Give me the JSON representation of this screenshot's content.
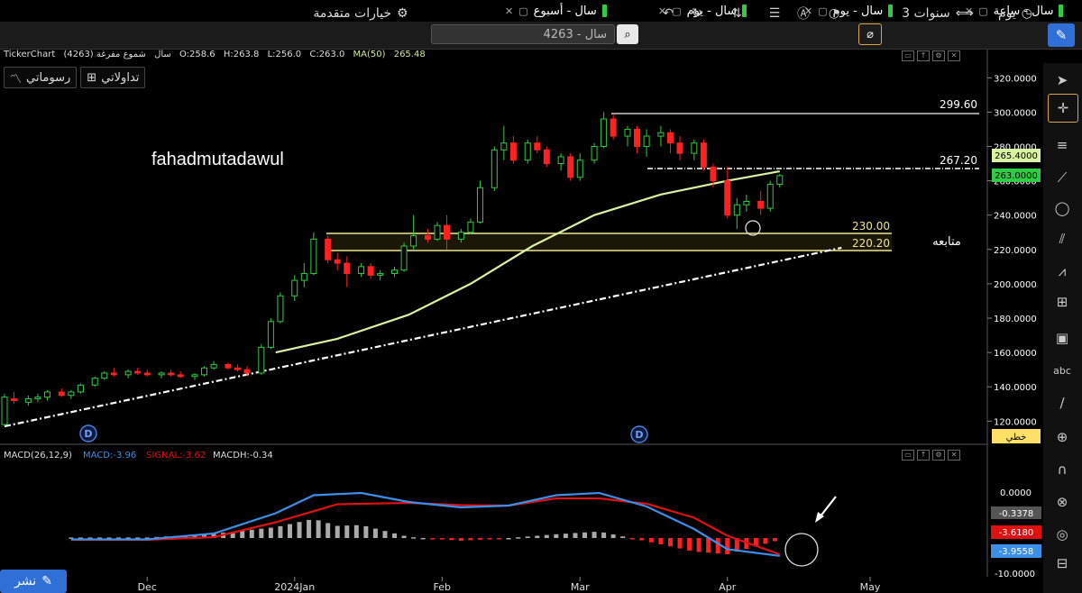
{
  "tabs": [
    {
      "label": "سال - ساعة"
    },
    {
      "label": "سال - يوم"
    },
    {
      "label": "سال - يوم"
    },
    {
      "label": "سال - أسبوع"
    }
  ],
  "toolbar": {
    "interval": "يوم",
    "range": "3 سنوات",
    "advanced_options": "خيارات متقدمة",
    "search_value": "4263 - سال"
  },
  "chart_info": {
    "app": "TickerChart",
    "symbol": "(4263) سال",
    "chart_kind": "شموع مفرغة",
    "open": "O:258.6",
    "high": "H:263.8",
    "low": "L:256.0",
    "close": "C:263.0",
    "ma_label": "MA(50)",
    "ma_value": "265.48"
  },
  "sub_buttons": {
    "trades": "تداولاتي",
    "drawings": "رسوماتي"
  },
  "watermark": "fahadmutadawul",
  "annotations": {
    "follow": "متابعه",
    "line_style": "خطي"
  },
  "price_axis": {
    "ticks": [
      "320.0000",
      "300.0000",
      "280.0000",
      "260.0000",
      "240.0000",
      "220.0000",
      "200.0000",
      "180.0000",
      "160.0000",
      "140.0000",
      "120.0000"
    ],
    "ma_tag": "265.4000",
    "close_tag": "263.0000"
  },
  "levels": [
    {
      "label": "299.60",
      "value": 299.6
    },
    {
      "label": "267.20",
      "value": 267.2
    },
    {
      "label": "230.00",
      "value": 230.0
    },
    {
      "label": "220.20",
      "value": 220.2
    }
  ],
  "macd": {
    "title": "MACD(26,12,9)",
    "macd_label": "MACD:-3.96",
    "signal_label": "SIGNAL:-3.62",
    "hist_label": "MACDH:-0.34",
    "ticks": [
      "0.0000",
      "-10.0000"
    ],
    "tags": [
      "-0.3378",
      "-3.6180",
      "-3.9558"
    ]
  },
  "x_axis": [
    "Dec",
    "2024Jan",
    "Feb",
    "Mar",
    "Apr",
    "May"
  ],
  "publish": "نشر",
  "colors": {
    "up": "#2ecc40",
    "down": "#ff2020",
    "ma": "#d9f2a0",
    "macd": "#3b8fe8",
    "signal": "#e01010",
    "level": "#f0e68c",
    "accent": "#2f6fd6"
  },
  "chart_data": {
    "type": "candlestick",
    "ylim": [
      115,
      330
    ],
    "x_range": [
      "2023-11-01",
      "2024-05-10"
    ],
    "ohlc": [
      {
        "date": "2023-11-01",
        "o": 118,
        "h": 136,
        "l": 117,
        "c": 134
      },
      {
        "date": "2023-11-03",
        "o": 133,
        "h": 137,
        "l": 130,
        "c": 132
      },
      {
        "date": "2023-11-06",
        "o": 131,
        "h": 135,
        "l": 129,
        "c": 133
      },
      {
        "date": "2023-11-08",
        "o": 133,
        "h": 136,
        "l": 131,
        "c": 134
      },
      {
        "date": "2023-11-10",
        "o": 134,
        "h": 138,
        "l": 132,
        "c": 137
      },
      {
        "date": "2023-11-13",
        "o": 137,
        "h": 139,
        "l": 134,
        "c": 135
      },
      {
        "date": "2023-11-15",
        "o": 135,
        "h": 138,
        "l": 133,
        "c": 137
      },
      {
        "date": "2023-11-17",
        "o": 137,
        "h": 142,
        "l": 136,
        "c": 141
      },
      {
        "date": "2023-11-20",
        "o": 141,
        "h": 146,
        "l": 140,
        "c": 145
      },
      {
        "date": "2023-11-22",
        "o": 145,
        "h": 149,
        "l": 144,
        "c": 148
      },
      {
        "date": "2023-11-24",
        "o": 148,
        "h": 151,
        "l": 146,
        "c": 147
      },
      {
        "date": "2023-11-27",
        "o": 147,
        "h": 150,
        "l": 145,
        "c": 149
      },
      {
        "date": "2023-11-29",
        "o": 149,
        "h": 151,
        "l": 147,
        "c": 148
      },
      {
        "date": "2023-12-01",
        "o": 148,
        "h": 150,
        "l": 146,
        "c": 147
      },
      {
        "date": "2023-12-04",
        "o": 147,
        "h": 149,
        "l": 145,
        "c": 148
      },
      {
        "date": "2023-12-06",
        "o": 148,
        "h": 150,
        "l": 146,
        "c": 147
      },
      {
        "date": "2023-12-08",
        "o": 147,
        "h": 149,
        "l": 145,
        "c": 146
      },
      {
        "date": "2023-12-11",
        "o": 146,
        "h": 148,
        "l": 144,
        "c": 147
      },
      {
        "date": "2023-12-13",
        "o": 147,
        "h": 152,
        "l": 146,
        "c": 151
      },
      {
        "date": "2023-12-15",
        "o": 151,
        "h": 155,
        "l": 150,
        "c": 153
      },
      {
        "date": "2023-12-18",
        "o": 153,
        "h": 154,
        "l": 150,
        "c": 151
      },
      {
        "date": "2023-12-20",
        "o": 151,
        "h": 153,
        "l": 149,
        "c": 150
      },
      {
        "date": "2023-12-22",
        "o": 150,
        "h": 152,
        "l": 146,
        "c": 148
      },
      {
        "date": "2023-12-25",
        "o": 148,
        "h": 165,
        "l": 147,
        "c": 163
      },
      {
        "date": "2023-12-27",
        "o": 163,
        "h": 180,
        "l": 162,
        "c": 178
      },
      {
        "date": "2023-12-29",
        "o": 178,
        "h": 195,
        "l": 177,
        "c": 193
      },
      {
        "date": "2024-01-01",
        "o": 193,
        "h": 205,
        "l": 190,
        "c": 202
      },
      {
        "date": "2024-01-03",
        "o": 202,
        "h": 212,
        "l": 198,
        "c": 206
      },
      {
        "date": "2024-01-05",
        "o": 206,
        "h": 230,
        "l": 205,
        "c": 226
      },
      {
        "date": "2024-01-08",
        "o": 226,
        "h": 228,
        "l": 212,
        "c": 214
      },
      {
        "date": "2024-01-10",
        "o": 214,
        "h": 218,
        "l": 208,
        "c": 212
      },
      {
        "date": "2024-01-12",
        "o": 212,
        "h": 216,
        "l": 198,
        "c": 206
      },
      {
        "date": "2024-01-15",
        "o": 206,
        "h": 212,
        "l": 204,
        "c": 210
      },
      {
        "date": "2024-01-17",
        "o": 210,
        "h": 212,
        "l": 203,
        "c": 205
      },
      {
        "date": "2024-01-19",
        "o": 205,
        "h": 208,
        "l": 202,
        "c": 206
      },
      {
        "date": "2024-01-22",
        "o": 206,
        "h": 210,
        "l": 204,
        "c": 208
      },
      {
        "date": "2024-01-24",
        "o": 208,
        "h": 224,
        "l": 207,
        "c": 222
      },
      {
        "date": "2024-01-26",
        "o": 222,
        "h": 240,
        "l": 220,
        "c": 228
      },
      {
        "date": "2024-01-29",
        "o": 228,
        "h": 232,
        "l": 224,
        "c": 226
      },
      {
        "date": "2024-01-31",
        "o": 226,
        "h": 236,
        "l": 225,
        "c": 234
      },
      {
        "date": "2024-02-02",
        "o": 234,
        "h": 240,
        "l": 220,
        "c": 226
      },
      {
        "date": "2024-02-05",
        "o": 226,
        "h": 232,
        "l": 224,
        "c": 230
      },
      {
        "date": "2024-02-07",
        "o": 230,
        "h": 238,
        "l": 229,
        "c": 236
      },
      {
        "date": "2024-02-09",
        "o": 236,
        "h": 260,
        "l": 235,
        "c": 256
      },
      {
        "date": "2024-02-12",
        "o": 256,
        "h": 280,
        "l": 254,
        "c": 278
      },
      {
        "date": "2024-02-14",
        "o": 278,
        "h": 292,
        "l": 272,
        "c": 282
      },
      {
        "date": "2024-02-16",
        "o": 282,
        "h": 286,
        "l": 270,
        "c": 272
      },
      {
        "date": "2024-02-19",
        "o": 272,
        "h": 284,
        "l": 270,
        "c": 282
      },
      {
        "date": "2024-02-21",
        "o": 282,
        "h": 286,
        "l": 276,
        "c": 278
      },
      {
        "date": "2024-02-23",
        "o": 278,
        "h": 280,
        "l": 268,
        "c": 270
      },
      {
        "date": "2024-02-26",
        "o": 270,
        "h": 276,
        "l": 266,
        "c": 274
      },
      {
        "date": "2024-02-28",
        "o": 274,
        "h": 276,
        "l": 260,
        "c": 262
      },
      {
        "date": "2024-03-01",
        "o": 262,
        "h": 276,
        "l": 260,
        "c": 272
      },
      {
        "date": "2024-03-04",
        "o": 272,
        "h": 282,
        "l": 270,
        "c": 280
      },
      {
        "date": "2024-03-06",
        "o": 280,
        "h": 300,
        "l": 279,
        "c": 296
      },
      {
        "date": "2024-03-08",
        "o": 296,
        "h": 299,
        "l": 284,
        "c": 286
      },
      {
        "date": "2024-03-11",
        "o": 286,
        "h": 292,
        "l": 280,
        "c": 290
      },
      {
        "date": "2024-03-13",
        "o": 290,
        "h": 292,
        "l": 276,
        "c": 280
      },
      {
        "date": "2024-03-15",
        "o": 280,
        "h": 290,
        "l": 274,
        "c": 286
      },
      {
        "date": "2024-03-18",
        "o": 286,
        "h": 292,
        "l": 280,
        "c": 288
      },
      {
        "date": "2024-03-20",
        "o": 288,
        "h": 290,
        "l": 276,
        "c": 282
      },
      {
        "date": "2024-03-22",
        "o": 282,
        "h": 286,
        "l": 272,
        "c": 276
      },
      {
        "date": "2024-03-25",
        "o": 276,
        "h": 284,
        "l": 272,
        "c": 282
      },
      {
        "date": "2024-03-27",
        "o": 282,
        "h": 284,
        "l": 266,
        "c": 268
      },
      {
        "date": "2024-03-29",
        "o": 268,
        "h": 270,
        "l": 256,
        "c": 260
      },
      {
        "date": "2024-04-01",
        "o": 260,
        "h": 268,
        "l": 238,
        "c": 240
      },
      {
        "date": "2024-04-03",
        "o": 240,
        "h": 250,
        "l": 232,
        "c": 246
      },
      {
        "date": "2024-04-05",
        "o": 246,
        "h": 252,
        "l": 242,
        "c": 248
      },
      {
        "date": "2024-04-08",
        "o": 248,
        "h": 254,
        "l": 240,
        "c": 244
      },
      {
        "date": "2024-04-10",
        "o": 244,
        "h": 260,
        "l": 242,
        "c": 258
      },
      {
        "date": "2024-04-12",
        "o": 258,
        "h": 264,
        "l": 256,
        "c": 263
      }
    ],
    "ma50": [
      {
        "date": "2023-12-28",
        "v": 160
      },
      {
        "date": "2024-01-10",
        "v": 168
      },
      {
        "date": "2024-01-25",
        "v": 182
      },
      {
        "date": "2024-02-07",
        "v": 200
      },
      {
        "date": "2024-02-20",
        "v": 222
      },
      {
        "date": "2024-03-04",
        "v": 240
      },
      {
        "date": "2024-03-18",
        "v": 252
      },
      {
        "date": "2024-04-01",
        "v": 260
      },
      {
        "date": "2024-04-12",
        "v": 265.5
      }
    ],
    "trendline": [
      {
        "date": "2023-11-01",
        "v": 117
      },
      {
        "date": "2024-04-25",
        "v": 221
      }
    ],
    "macd_series": {
      "ylim": [
        -11,
        5
      ],
      "macd": [
        {
          "date": "2023-11-15",
          "v": -0.3
        },
        {
          "date": "2023-12-01",
          "v": -0.3
        },
        {
          "date": "2023-12-15",
          "v": 1.0
        },
        {
          "date": "2023-12-28",
          "v": 5.5
        },
        {
          "date": "2024-01-05",
          "v": 9.5
        },
        {
          "date": "2024-01-15",
          "v": 10.0
        },
        {
          "date": "2024-01-25",
          "v": 8.0
        },
        {
          "date": "2024-02-05",
          "v": 6.8
        },
        {
          "date": "2024-02-15",
          "v": 7.2
        },
        {
          "date": "2024-02-25",
          "v": 9.5
        },
        {
          "date": "2024-03-05",
          "v": 10.0
        },
        {
          "date": "2024-03-15",
          "v": 7.0
        },
        {
          "date": "2024-03-25",
          "v": 2.0
        },
        {
          "date": "2024-04-01",
          "v": -2.5
        },
        {
          "date": "2024-04-12",
          "v": -3.96
        }
      ],
      "signal": [
        {
          "date": "2023-11-15",
          "v": -0.4
        },
        {
          "date": "2023-12-01",
          "v": -0.4
        },
        {
          "date": "2023-12-15",
          "v": 0.2
        },
        {
          "date": "2023-12-28",
          "v": 3.5
        },
        {
          "date": "2024-01-10",
          "v": 7.5
        },
        {
          "date": "2024-01-25",
          "v": 7.8
        },
        {
          "date": "2024-02-05",
          "v": 7.3
        },
        {
          "date": "2024-02-15",
          "v": 7.2
        },
        {
          "date": "2024-02-25",
          "v": 8.8
        },
        {
          "date": "2024-03-05",
          "v": 8.8
        },
        {
          "date": "2024-03-15",
          "v": 7.6
        },
        {
          "date": "2024-03-25",
          "v": 4.5
        },
        {
          "date": "2024-04-01",
          "v": 0.5
        },
        {
          "date": "2024-04-12",
          "v": -3.62
        }
      ]
    }
  }
}
